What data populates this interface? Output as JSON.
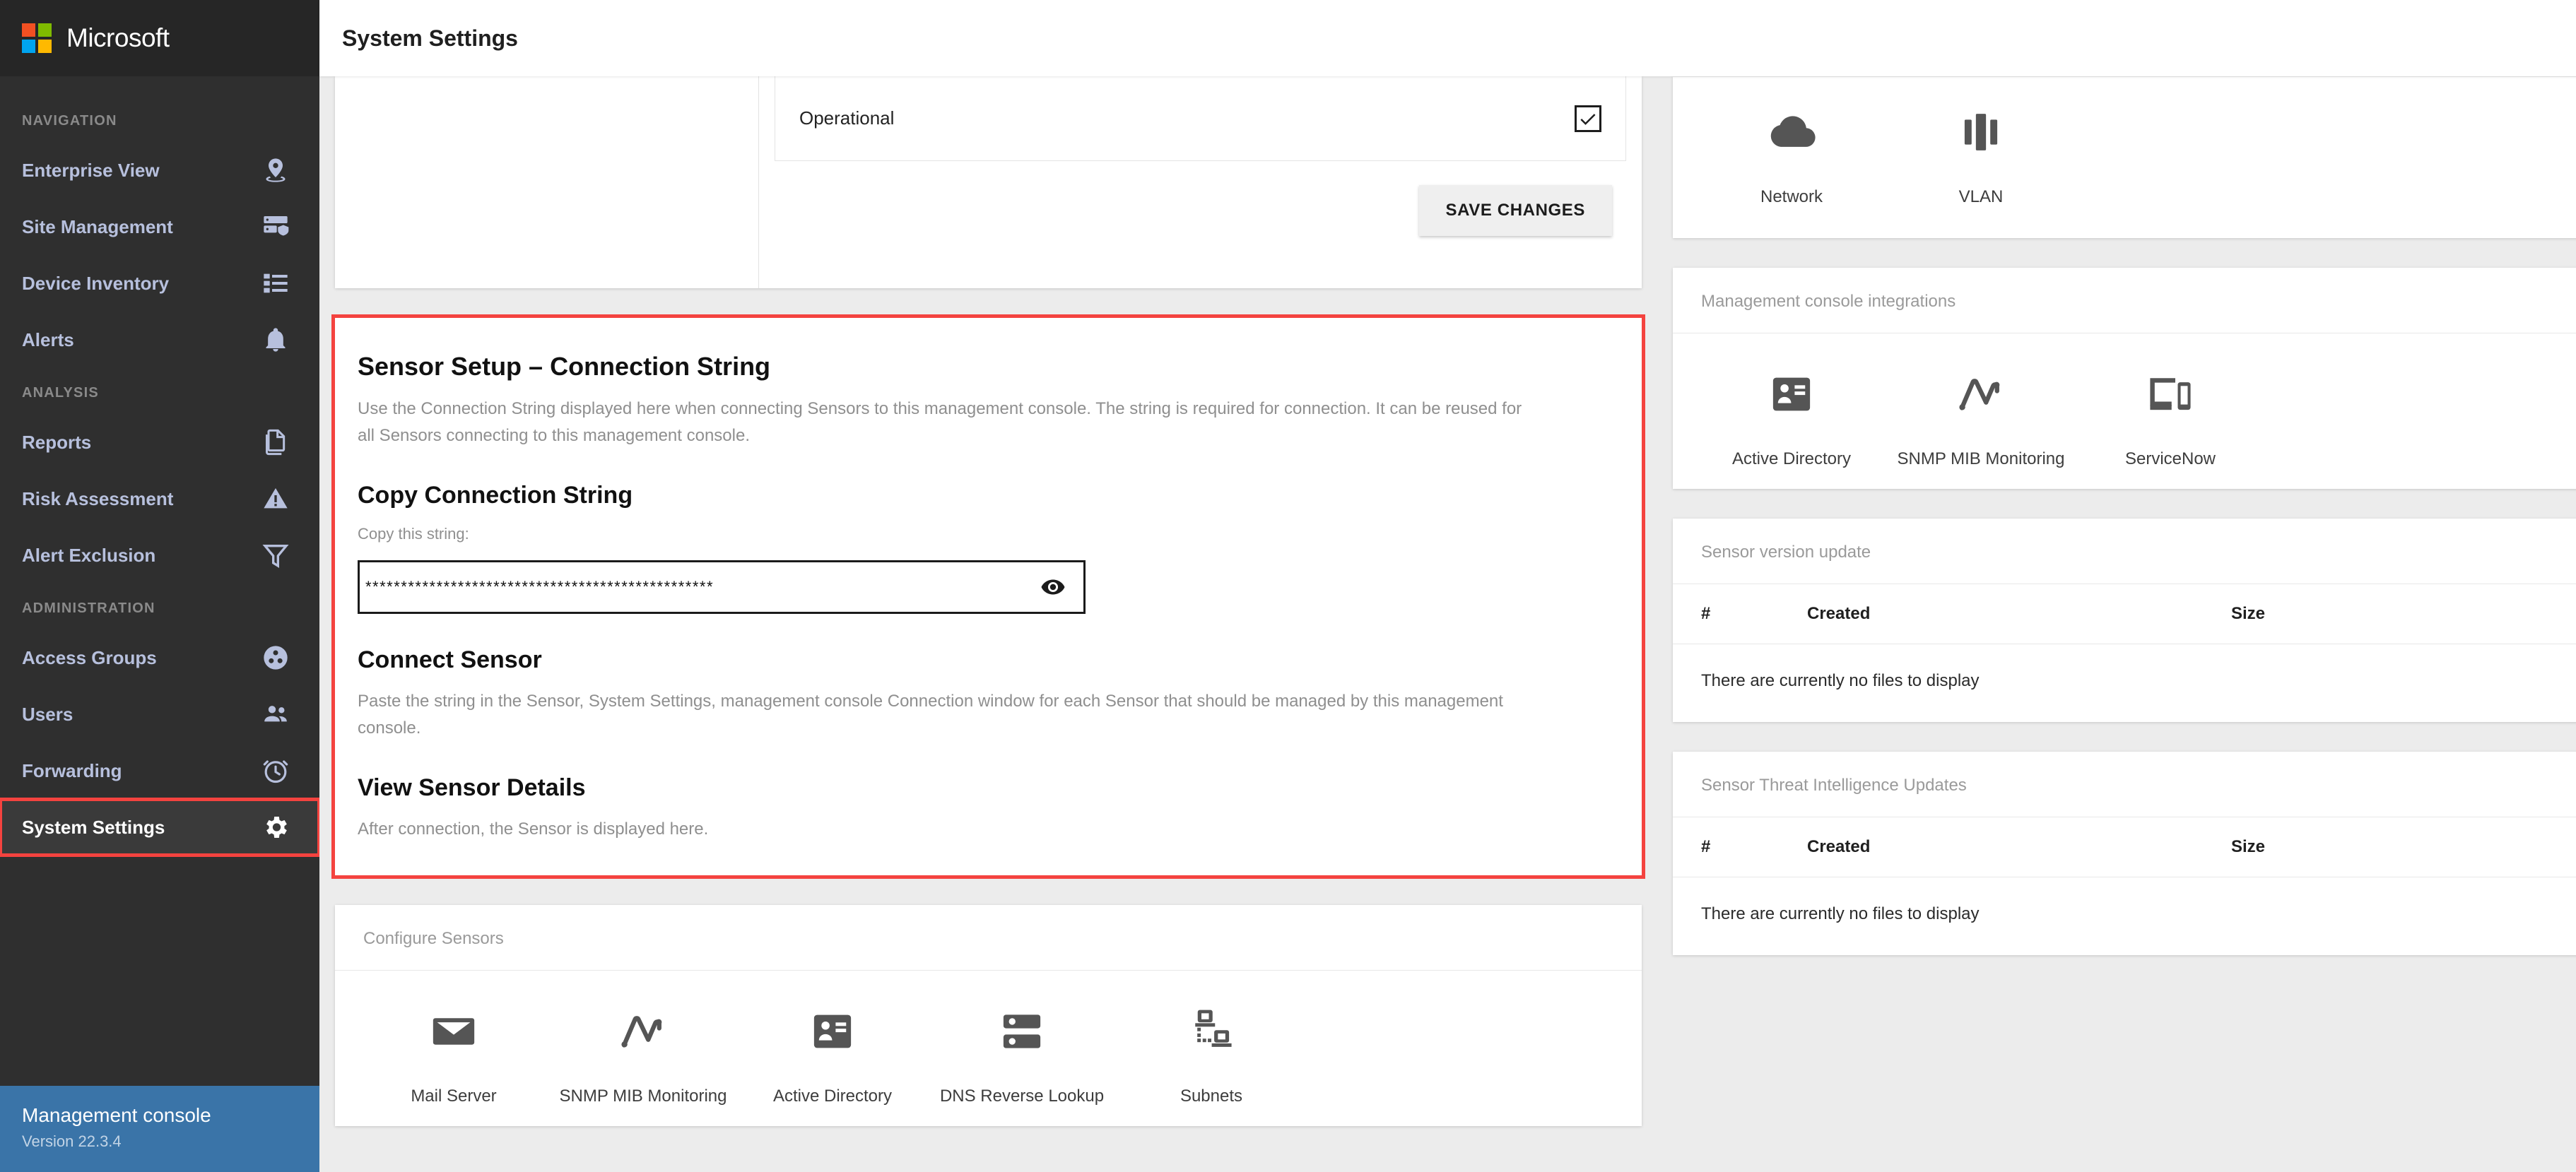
{
  "brand": {
    "name": "Microsoft",
    "logo_colors": [
      "#f25022",
      "#7fba00",
      "#00a4ef",
      "#ffb900"
    ]
  },
  "sidebar": {
    "sections": [
      {
        "label": "NAVIGATION",
        "items": [
          {
            "label": "Enterprise View",
            "icon": "map-pin-icon"
          },
          {
            "label": "Site Management",
            "icon": "site-shield-icon"
          },
          {
            "label": "Device Inventory",
            "icon": "list-icon"
          },
          {
            "label": "Alerts",
            "icon": "bell-icon"
          }
        ]
      },
      {
        "label": "ANALYSIS",
        "items": [
          {
            "label": "Reports",
            "icon": "documents-icon"
          },
          {
            "label": "Risk Assessment",
            "icon": "warning-triangle-icon"
          },
          {
            "label": "Alert Exclusion",
            "icon": "funnel-icon"
          }
        ]
      },
      {
        "label": "ADMINISTRATION",
        "items": [
          {
            "label": "Access Groups",
            "icon": "access-group-icon"
          },
          {
            "label": "Users",
            "icon": "people-icon"
          },
          {
            "label": "Forwarding",
            "icon": "clock-icon"
          },
          {
            "label": "System Settings",
            "icon": "gear-icon"
          }
        ]
      }
    ],
    "footer": {
      "title": "Management console",
      "version": "Version 22.3.4"
    },
    "highlight_color": "#f4433f"
  },
  "topbar": {
    "title": "System Settings",
    "account_icon": "account-circle-icon"
  },
  "status_block": {
    "operational_label": "Operational",
    "operational_checked": true,
    "save_label": "SAVE CHANGES"
  },
  "sensor_setup": {
    "title": "Sensor Setup – Connection String",
    "intro": "Use the Connection String displayed here when connecting Sensors to this management console. The string is required for connection. It can be reused for all Sensors connecting to this management console.",
    "copy_heading": "Copy Connection String",
    "copy_label": "Copy this string:",
    "connection_string_masked": "*************************************************",
    "reveal_icon": "eye-icon",
    "connect_heading": "Connect Sensor",
    "connect_text": "Paste the string in the Sensor, System Settings, management console Connection window for each Sensor that should be managed by this management console.",
    "view_heading": "View Sensor Details",
    "view_text": "After connection, the Sensor is displayed here."
  },
  "configure_sensors": {
    "title": "Configure Sensors",
    "tiles": [
      {
        "label": "Mail Server",
        "icon": "mail-icon"
      },
      {
        "label": "SNMP MIB Monitoring",
        "icon": "snmp-chart-icon"
      },
      {
        "label": "Active Directory",
        "icon": "id-card-icon"
      },
      {
        "label": "DNS Reverse Lookup",
        "icon": "server-icon"
      },
      {
        "label": "Subnets",
        "icon": "subnets-icon"
      }
    ]
  },
  "network_panel": {
    "tiles": [
      {
        "label": "Network",
        "icon": "cloud-icon"
      },
      {
        "label": "VLAN",
        "icon": "vlan-icon"
      }
    ]
  },
  "integrations_panel": {
    "title": "Management console integrations",
    "tiles": [
      {
        "label": "Active Directory",
        "icon": "id-card-icon"
      },
      {
        "label": "SNMP MIB Monitoring",
        "icon": "snmp-chart-icon"
      },
      {
        "label": "ServiceNow",
        "icon": "devices-icon"
      }
    ]
  },
  "sensor_version_update": {
    "title": "Sensor version update",
    "add_icon": "plus-icon",
    "columns": [
      "#",
      "Created",
      "Size"
    ],
    "rows": [],
    "empty_text": "There are currently no files to display"
  },
  "sensor_threat_intel": {
    "title": "Sensor Threat Intelligence Updates",
    "add_icon": "plus-icon",
    "columns": [
      "#",
      "Created",
      "Size"
    ],
    "rows": [],
    "empty_text": "There are currently no files to display"
  }
}
